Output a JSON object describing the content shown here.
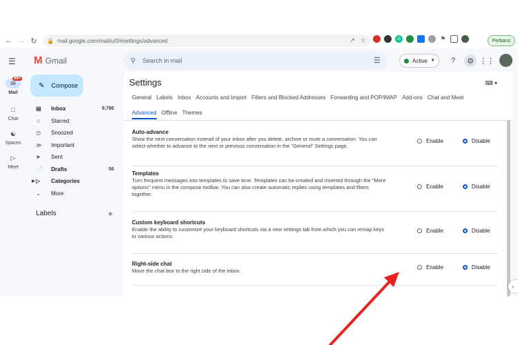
{
  "browser": {
    "url": "mail.google.com/mail/u/0/#settings/advanced",
    "profile_label": "Perbarui"
  },
  "app": {
    "name": "Gmail",
    "search_placeholder": "Search in mail",
    "status": "Active"
  },
  "rail": {
    "mail": "Mail",
    "mail_badge": "99+",
    "chat": "Chat",
    "spaces": "Spaces",
    "meet": "Meet"
  },
  "sidebar": {
    "compose": "Compose",
    "items": [
      {
        "label": "Inbox",
        "count": "9,786",
        "icon": "inbox-icon"
      },
      {
        "label": "Starred",
        "count": "",
        "icon": "star-icon"
      },
      {
        "label": "Snoozed",
        "count": "",
        "icon": "clock-icon"
      },
      {
        "label": "Important",
        "count": "",
        "icon": "important-icon"
      },
      {
        "label": "Sent",
        "count": "",
        "icon": "send-icon"
      },
      {
        "label": "Drafts",
        "count": "56",
        "icon": "draft-icon"
      },
      {
        "label": "Categories",
        "count": "",
        "icon": "label-icon"
      },
      {
        "label": "More",
        "count": "",
        "icon": "chevron-down-icon"
      }
    ],
    "labels_heading": "Labels"
  },
  "settings": {
    "title": "Settings",
    "tabs_row1": [
      "General",
      "Labels",
      "Inbox",
      "Accounts and Import",
      "Filters and Blocked Addresses",
      "Forwarding and POP/IMAP",
      "Add-ons",
      "Chat and Meet"
    ],
    "tabs_row2": [
      "Advanced",
      "Offline",
      "Themes"
    ],
    "rows": [
      {
        "title": "Auto-advance",
        "desc": "Show the next conversation instead of your inbox after you delete, archive or mute a conversation. You can select whether to advance to the next or previous conversation in the \"General\" Settings page.",
        "enable": "Enable",
        "disable": "Disable"
      },
      {
        "title": "Templates",
        "desc": "Turn frequent messages into templates to save time. Templates can be created and inserted through the \"More options\" menu in the compose toolbar. You can also create automatic replies using templates and filters together.",
        "enable": "Enable",
        "disable": "Disable"
      },
      {
        "title": "Custom keyboard shortcuts",
        "desc": "Enable the ability to customize your keyboard shortcuts via a new settings tab from which you can remap keys to various actions.",
        "enable": "Enable",
        "disable": "Disable"
      },
      {
        "title": "Right-side chat",
        "desc": "Move the chat box to the right side of the inbox.",
        "enable": "Enable",
        "disable": "Disable"
      }
    ]
  },
  "colors": {
    "accent": "#0b57d0",
    "arrow": "#e8231e",
    "compose_bg": "#c2e7ff"
  }
}
